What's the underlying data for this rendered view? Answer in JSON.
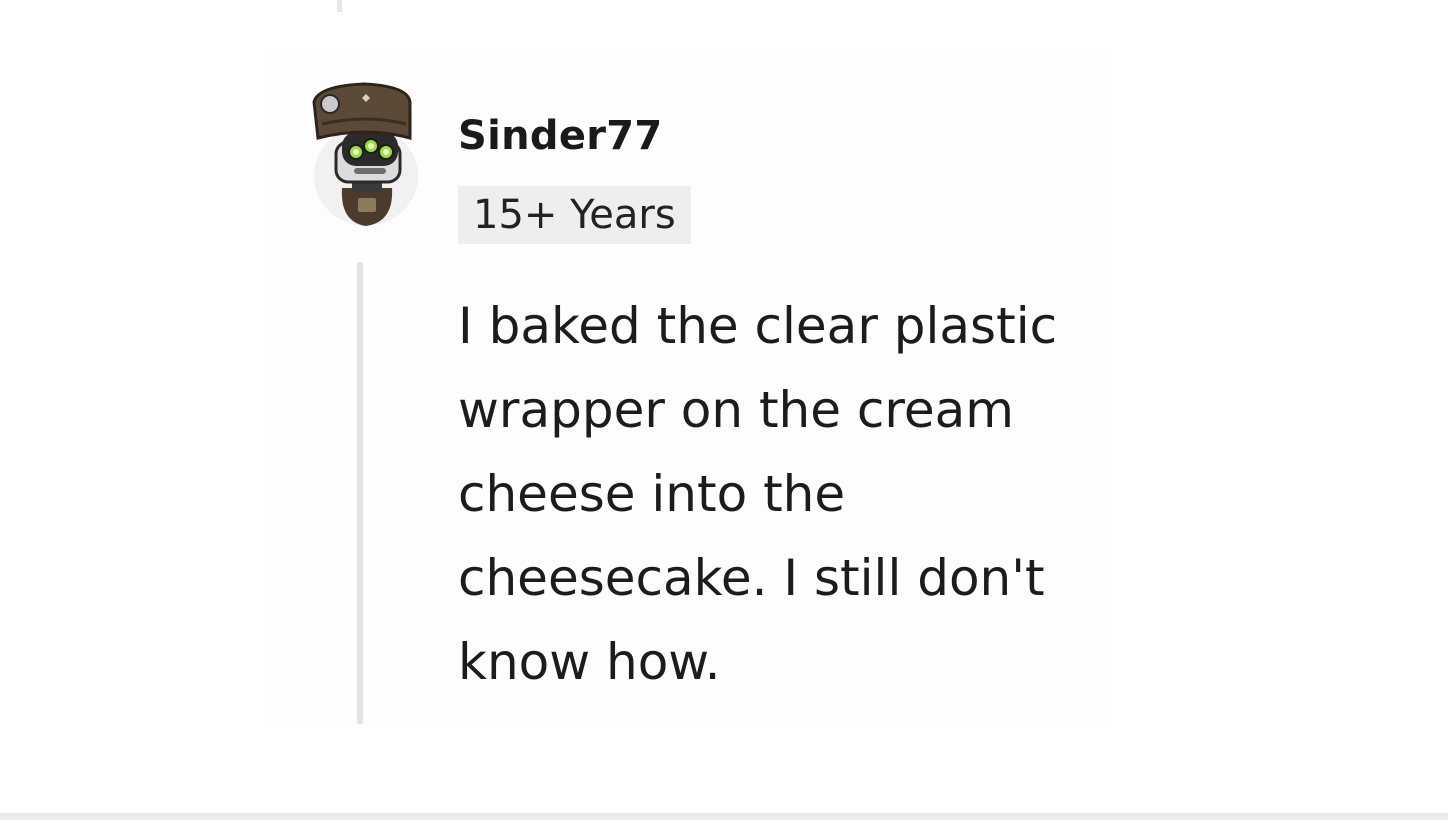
{
  "comment": {
    "author": "Sinder77",
    "author_avatar": "robot-avatar-icon",
    "flair": "15+ Years",
    "body": "I baked the clear plastic wrapper on the cream cheese into the cheesecake. I still don't know how."
  },
  "colors": {
    "page_background": "#ffffff",
    "card_background": "#fdfdfd",
    "flair_background": "#eeeeee",
    "thread_line": "#e3e3e3",
    "text": "#1a1a1b"
  }
}
